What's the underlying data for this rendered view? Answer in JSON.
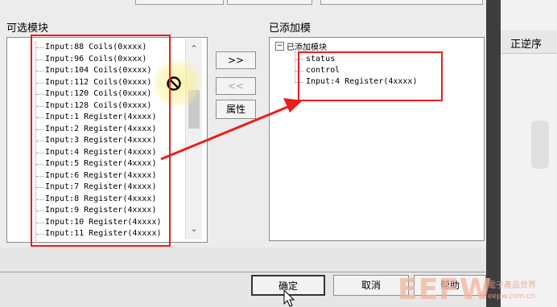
{
  "available_group": {
    "label": "可选模块",
    "items": [
      "Input:88 Coils(0xxxx)",
      "Input:96 Coils(0xxxx)",
      "Input:104 Coils(0xxxx)",
      "Input:112 Coils(0xxxx)",
      "Input:120 Coils(0xxxx)",
      "Input:128 Coils(0xxxx)",
      "Input:1 Register(4xxxx)",
      "Input:2 Register(4xxxx)",
      "Input:3 Register(4xxxx)",
      "Input:4 Register(4xxxx)",
      "Input:5 Register(4xxxx)",
      "Input:6 Register(4xxxx)",
      "Input:7 Register(4xxxx)",
      "Input:8 Register(4xxxx)",
      "Input:9 Register(4xxxx)",
      "Input:10 Register(4xxxx)",
      "Input:11 Register(4xxxx)"
    ]
  },
  "middle_buttons": {
    "add": ">>",
    "remove": "<<",
    "properties": "属性"
  },
  "added_group": {
    "label": "已添加模",
    "root": "已添加模块",
    "expander": "−",
    "children": [
      "status",
      "control",
      "Input:4 Register(4xxxx)"
    ]
  },
  "footer": {
    "ok": "确定",
    "cancel": "取消",
    "help": "帮助"
  },
  "background_app": {
    "header": "正逆序"
  },
  "watermark": {
    "logo": "EEFW",
    "tagline": "電子產品世界",
    "url": "eepw.com.cn"
  },
  "colors": {
    "annotation_red": "#ee1c1c",
    "list_background": "#ffffff",
    "dialog_background": "#ececec"
  }
}
